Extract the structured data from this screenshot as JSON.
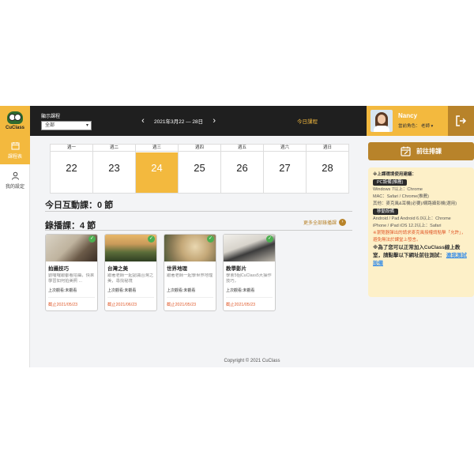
{
  "app": {
    "logo_text": "CuClass"
  },
  "header": {
    "filter_label": "顯示課程",
    "filter_value": "全部",
    "prev": "‹",
    "next": "›",
    "week_range": "2021年3月22 — 28日",
    "today_label": "今日課程",
    "user_name": "Nancy",
    "user_role": "當前角色： 老師 ▾"
  },
  "sidebar": {
    "items": [
      {
        "label": "課程表",
        "icon": "calendar-icon",
        "active": true
      },
      {
        "label": "我的設定",
        "icon": "user-icon",
        "active": false
      }
    ]
  },
  "calendar": {
    "days": [
      {
        "weekday": "週一",
        "date": "22"
      },
      {
        "weekday": "週二",
        "date": "23"
      },
      {
        "weekday": "週三",
        "date": "24",
        "today": true
      },
      {
        "weekday": "週四",
        "date": "25"
      },
      {
        "weekday": "週五",
        "date": "26"
      },
      {
        "weekday": "週六",
        "date": "27"
      },
      {
        "weekday": "週日",
        "date": "28"
      }
    ]
  },
  "interactive": {
    "title": "今日互動課：0 節"
  },
  "recorded": {
    "title": "錄播課：4 節",
    "more_link": "更多全部錄播課",
    "courses": [
      {
        "title": "拍攝技巧",
        "desc": "劉囉囉跟都看拍攝，快來學習如何拍美照 ...",
        "last": "上次觀看:未觀看",
        "deadline": "截止2021/05/23"
      },
      {
        "title": "台灣之美",
        "desc": "跟著老師一起認識台灣之美，尋找秘境",
        "last": "上次觀看:未觀看",
        "deadline": "截止2021/06/23"
      },
      {
        "title": "世界地理",
        "desc": "跟著老師一起學世界地理",
        "last": "上次觀看:未觀看",
        "deadline": "截止2021/05/23"
      },
      {
        "title": "教學影片",
        "desc": "學會5個CuClass5大操作技巧，",
        "last": "上次觀看:未觀看",
        "deadline": "截止2021/05/23"
      }
    ]
  },
  "right_panel": {
    "schedule_button": "前往排課",
    "notice": {
      "heading": "※上課環境使用建議：",
      "pc_tag": "PC設備(推薦)",
      "pc_lines": [
        "Windows 7以上：Chrome",
        "MAC：Safari / Chrome(推薦)",
        "其他：麥克風&耳機(必要)/網路攝影機(選用)"
      ],
      "mobile_tag": "移動設備",
      "mobile_lines": [
        "Android / Pad Android 6.0以上：Chrome",
        "iPhone / iPad iOS 12.2以上：Safari"
      ],
      "warn": "※瀏覽器彈出的請求麥克風授權請點擊「允許」，避免無法於課堂上發言。",
      "big": "※為了您可以正常加入CuClass線上教室，請點擊以下網址前往測試：",
      "link": "連我測試設備"
    }
  },
  "footer": {
    "text": "Copyright © 2021 CuClass"
  }
}
